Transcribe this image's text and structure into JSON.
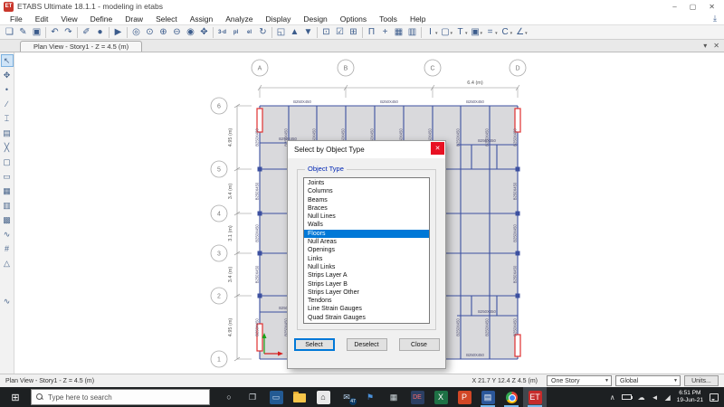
{
  "window": {
    "title": "ETABS Ultimate 18.1.1 - modeling in etabs",
    "app_icon_text": "ET",
    "controls": {
      "minimize": "–",
      "maximize": "▢",
      "close": "✕"
    }
  },
  "menu": {
    "items": [
      "File",
      "Edit",
      "View",
      "Define",
      "Draw",
      "Select",
      "Assign",
      "Analyze",
      "Display",
      "Design",
      "Options",
      "Tools",
      "Help"
    ]
  },
  "toolbar": {
    "icons": [
      {
        "name": "new-model-icon",
        "glyph": "❏"
      },
      {
        "name": "open-model-icon",
        "glyph": "✎"
      },
      {
        "name": "save-model-icon",
        "glyph": "▣"
      },
      {
        "name": "sep"
      },
      {
        "name": "undo-icon",
        "glyph": "↶"
      },
      {
        "name": "redo-icon",
        "glyph": "↷"
      },
      {
        "name": "sep"
      },
      {
        "name": "edit-icon",
        "glyph": "✐"
      },
      {
        "name": "lock-model-icon",
        "glyph": "●"
      },
      {
        "name": "sep"
      },
      {
        "name": "run-analysis-icon",
        "glyph": "▶"
      },
      {
        "name": "sep"
      },
      {
        "name": "rubber-band-zoom-icon",
        "glyph": "◎"
      },
      {
        "name": "restore-full-view-icon",
        "glyph": "⊙"
      },
      {
        "name": "zoom-in-icon",
        "glyph": "⊕"
      },
      {
        "name": "zoom-out-icon",
        "glyph": "⊖"
      },
      {
        "name": "previous-zoom-icon",
        "glyph": "◉"
      },
      {
        "name": "pan-icon",
        "glyph": "✥"
      },
      {
        "name": "sep"
      },
      {
        "name": "3d-view-icon",
        "glyph": "3-d",
        "text": true
      },
      {
        "name": "plan-view-icon",
        "glyph": "pl",
        "text": true
      },
      {
        "name": "elevation-view-icon",
        "glyph": "el",
        "text": true
      },
      {
        "name": "rotate-view-icon",
        "glyph": "↻"
      },
      {
        "name": "sep"
      },
      {
        "name": "perspective-icon",
        "glyph": "◱"
      },
      {
        "name": "move-up-story-icon",
        "glyph": "▲"
      },
      {
        "name": "move-down-story-icon",
        "glyph": "▼"
      },
      {
        "name": "sep"
      },
      {
        "name": "object-shrink-icon",
        "glyph": "⊡"
      },
      {
        "name": "display-options-icon",
        "glyph": "☑"
      },
      {
        "name": "window-arrange-icon",
        "glyph": "⊞"
      },
      {
        "name": "sep"
      },
      {
        "name": "draw-portal-icon",
        "glyph": "Π"
      },
      {
        "name": "snap-points-icon",
        "glyph": "+"
      },
      {
        "name": "grid-options-icon",
        "glyph": "▦"
      },
      {
        "name": "wall-stack-icon",
        "glyph": "▥"
      },
      {
        "name": "sep"
      },
      {
        "name": "frame-section-icon",
        "glyph": "I",
        "dd": true
      },
      {
        "name": "area-section-icon",
        "glyph": "▢",
        "dd": true
      },
      {
        "name": "tee-section-icon",
        "glyph": "T",
        "dd": true
      },
      {
        "name": "wall-section-icon",
        "glyph": "▣",
        "dd": true
      },
      {
        "name": "dimension-icon",
        "glyph": "=",
        "dd": true
      },
      {
        "name": "channel-section-icon",
        "glyph": "C",
        "dd": true
      },
      {
        "name": "angle-section-icon",
        "glyph": "∠",
        "dd": true
      }
    ]
  },
  "side_toolbar": {
    "icons": [
      {
        "name": "pointer-select-icon",
        "glyph": "↖",
        "active": true
      },
      {
        "name": "reshape-icon",
        "glyph": "✥"
      },
      {
        "name": "draw-joint-icon",
        "glyph": "•"
      },
      {
        "name": "draw-frame-icon",
        "glyph": "∕"
      },
      {
        "name": "quick-draw-frame-icon",
        "glyph": "⌶"
      },
      {
        "name": "quick-draw-secondary-beams-icon",
        "glyph": "▤"
      },
      {
        "name": "quick-draw-braces-icon",
        "glyph": "╳"
      },
      {
        "name": "draw-floor-icon",
        "glyph": "▢"
      },
      {
        "name": "draw-rect-floor-icon",
        "glyph": "▭"
      },
      {
        "name": "quick-draw-floor-icon",
        "glyph": "▦"
      },
      {
        "name": "draw-wall-icon",
        "glyph": "▥"
      },
      {
        "name": "quick-draw-wall-icon",
        "glyph": "▩"
      },
      {
        "name": "draw-link-icon",
        "glyph": "∿"
      },
      {
        "name": "draw-grid-icon",
        "glyph": "#"
      },
      {
        "name": "draw-reference-icon",
        "glyph": "△"
      },
      {
        "name": "gap"
      },
      {
        "name": "plot-function-icon",
        "glyph": "∿"
      }
    ]
  },
  "tab": {
    "label": "Plan View - Story1 - Z = 4.5 (m)",
    "dropdown_icon": "▾",
    "close_icon": "✕"
  },
  "dialog": {
    "title": "Select by Object Type",
    "close_icon": "✕",
    "group_label": "Object Type",
    "items": [
      "Joints",
      "Columns",
      "Beams",
      "Braces",
      "Null Lines",
      "Walls",
      "Floors",
      "Null Areas",
      "Openings",
      "Links",
      "Null Links",
      "Strips Layer A",
      "Strips Layer B",
      "Strips Layer Other",
      "Tendons",
      "Line Strain Gauges",
      "Quad Strain Gauges"
    ],
    "selected_item": "Floors",
    "buttons": {
      "select": "Select",
      "deselect": "Deselect",
      "close": "Close"
    }
  },
  "plan": {
    "grid_cols": [
      "A",
      "B",
      "C",
      "D"
    ],
    "grid_rows": [
      "6",
      "5",
      "4",
      "3",
      "2",
      "1"
    ],
    "row_dims": [
      "4.95 (m)",
      "3.4 (m)",
      "3.1 (m)",
      "3.4 (m)",
      "4.95 (m)"
    ],
    "top_dim": "6.4 (m)",
    "beam_label": "B250X450"
  },
  "status_bar": {
    "left": "Plan View - Story1 - Z = 4.5 (m)",
    "coords": "X 21.7  Y 12.4  Z 4.5 (m)",
    "story_select": "One Story",
    "coord_system": "Global",
    "units_button": "Units...",
    "dropdown_icon": "▼"
  },
  "taskbar": {
    "search_placeholder": "Type here to search",
    "apps": [
      {
        "name": "cortana-icon",
        "glyph": "○",
        "fg": "#dfe5ea"
      },
      {
        "name": "task-view-icon",
        "glyph": "❐",
        "fg": "#dfe5ea"
      },
      {
        "name": "remote-desktop-icon",
        "glyph": "▭",
        "bg": "#235a93",
        "fg": "#cfe2f5"
      },
      {
        "name": "file-explorer-icon",
        "folder": true
      },
      {
        "name": "store-icon",
        "glyph": "⌂",
        "bg": "#e9e9e9",
        "fg": "#333"
      },
      {
        "name": "mail-icon",
        "glyph": "✉",
        "fg": "#bcd9f5",
        "badge": "47"
      },
      {
        "name": "feedback-icon",
        "glyph": "⚑",
        "fg": "#4a90d9"
      },
      {
        "name": "calculator-icon",
        "glyph": "▦",
        "fg": "#cfd8dc"
      },
      {
        "name": "design-app-icon",
        "glyph": "DE",
        "bg": "#2b3f63",
        "fg": "#ff6b6b",
        "small": true
      },
      {
        "name": "excel-icon",
        "glyph": "X",
        "bg": "#1e7145",
        "fg": "#fff"
      },
      {
        "name": "powerpoint-icon",
        "glyph": "P",
        "bg": "#d24726",
        "fg": "#fff"
      },
      {
        "name": "word-app-icon",
        "glyph": "▤",
        "bg": "#2b579a",
        "fg": "#fff",
        "running": true
      },
      {
        "name": "chrome-icon",
        "chrome": true,
        "running": true
      },
      {
        "name": "etabs-taskbar-icon",
        "glyph": "ET",
        "bg": "#c62b2b",
        "fg": "#fff",
        "running": true,
        "active": true
      }
    ],
    "tray": {
      "chevron": "∧",
      "cloud": "☁",
      "speaker": "◄",
      "network": "◢",
      "time": "6:51 PM",
      "date": "19-Jun-21"
    }
  }
}
